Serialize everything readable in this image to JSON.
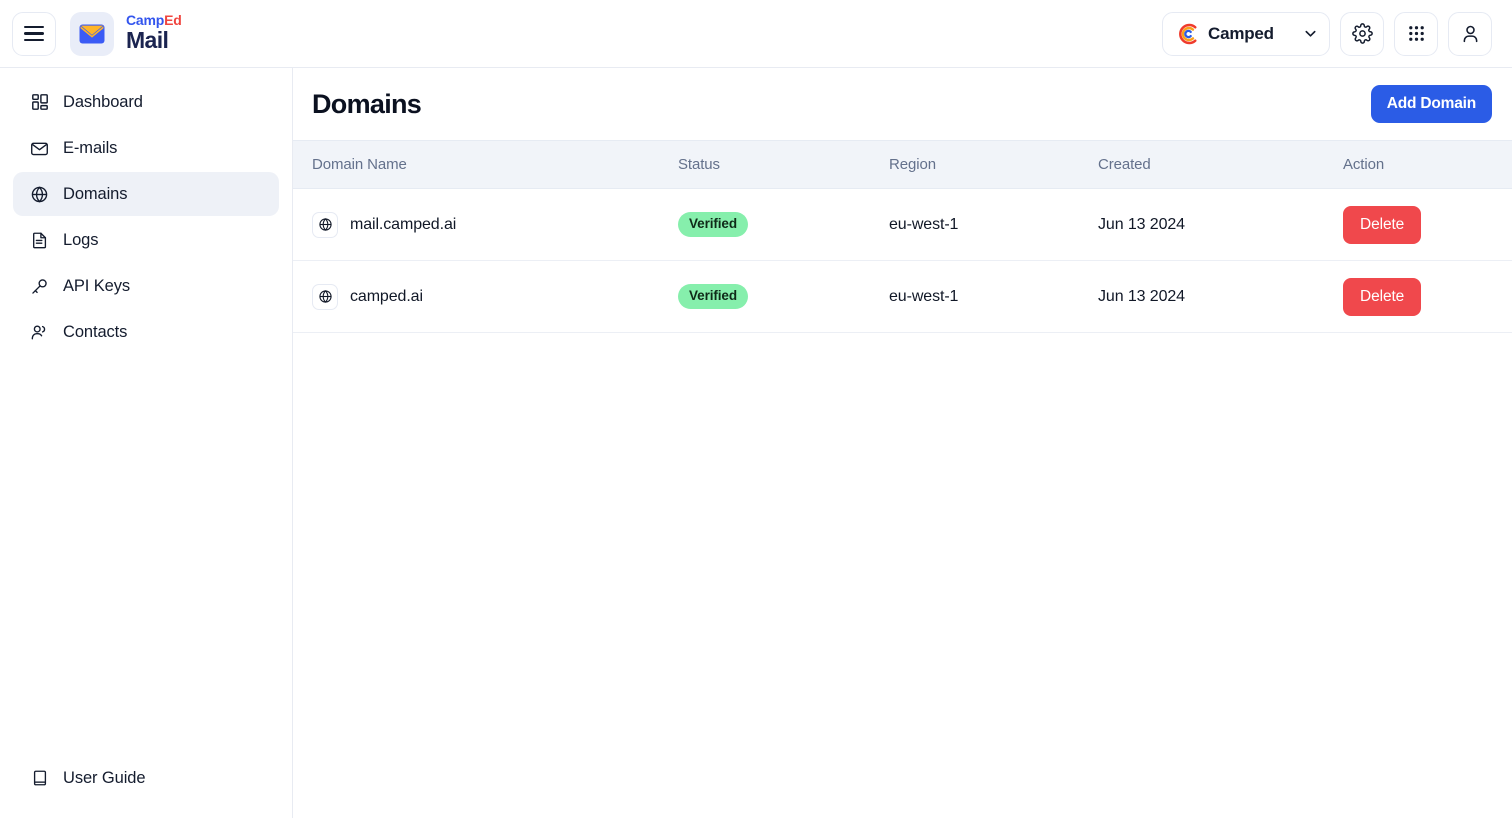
{
  "topbar": {
    "menu_icon": "hamburger-menu-icon",
    "brand": {
      "prefix": "Camp",
      "suffix": "Ed",
      "product": "Mail",
      "mark_icon": "envelope-icon"
    },
    "workspace": {
      "name": "Camped",
      "logo_icon": "camped-c-logo-icon",
      "chevron_icon": "chevron-down-icon"
    },
    "settings_icon": "gear-icon",
    "apps_icon": "grid-apps-icon",
    "profile_icon": "user-avatar-icon",
    "colors": {
      "brand_blue": "#3355ee",
      "brand_red": "#f0453f",
      "brand_navy": "#1b2450"
    }
  },
  "sidebar": {
    "items": [
      {
        "label": "Dashboard",
        "icon": "dashboard-grid-icon",
        "active": false
      },
      {
        "label": "E-mails",
        "icon": "envelope-icon",
        "active": false
      },
      {
        "label": "Domains",
        "icon": "globe-icon",
        "active": true
      },
      {
        "label": "Logs",
        "icon": "document-lines-icon",
        "active": false
      },
      {
        "label": "API Keys",
        "icon": "key-icon",
        "active": false
      },
      {
        "label": "Contacts",
        "icon": "people-icon",
        "active": false
      }
    ],
    "footer": {
      "label": "User Guide",
      "icon": "book-icon"
    }
  },
  "main": {
    "title": "Domains",
    "add_button": "Add Domain",
    "table": {
      "columns": [
        "Domain Name",
        "Status",
        "Region",
        "Created",
        "Action"
      ],
      "rows": [
        {
          "domain": "mail.camped.ai",
          "domain_icon": "globe-icon",
          "status": "Verified",
          "region": "eu-west-1",
          "created": "Jun 13 2024",
          "action": "Delete"
        },
        {
          "domain": "camped.ai",
          "domain_icon": "globe-icon",
          "status": "Verified",
          "region": "eu-west-1",
          "created": "Jun 13 2024",
          "action": "Delete"
        }
      ]
    }
  },
  "colors": {
    "primary_button": "#2b5ce6",
    "delete_button": "#f0484c",
    "badge_verified_bg": "#86efac",
    "table_header_bg": "#f1f4f9",
    "sidebar_active_bg": "#eef1f7"
  }
}
